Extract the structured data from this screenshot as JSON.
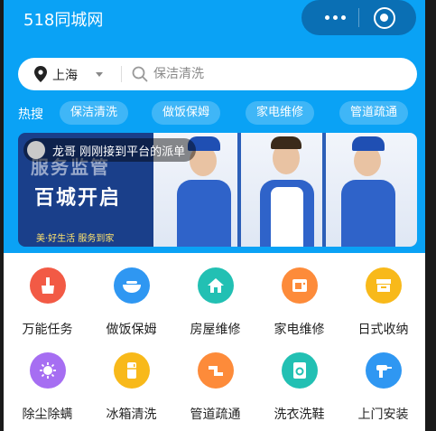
{
  "header": {
    "title": "518同城网"
  },
  "search": {
    "city": "上海",
    "placeholder": "保洁清洗"
  },
  "hot": {
    "label": "热搜",
    "chips": [
      "保洁清洗",
      "做饭保姆",
      "家电维修",
      "管道疏通"
    ]
  },
  "banner": {
    "toast": "龙哥 刚刚接到平台的派单",
    "line1": "服务监管",
    "line2": "百城开启",
    "slogan": "美·好生活  服务到家"
  },
  "services": [
    {
      "label": "万能任务",
      "icon": "broom-icon",
      "color": "#f25a45"
    },
    {
      "label": "做饭保姆",
      "icon": "bowl-icon",
      "color": "#2f97f2"
    },
    {
      "label": "房屋维修",
      "icon": "house-icon",
      "color": "#22c0b3"
    },
    {
      "label": "家电维修",
      "icon": "appliance-icon",
      "color": "#fd8b3a"
    },
    {
      "label": "日式收纳",
      "icon": "storage-box-icon",
      "color": "#f8b91a"
    },
    {
      "label": "除尘除螨",
      "icon": "mite-icon",
      "color": "#a66ef2"
    },
    {
      "label": "冰箱清洗",
      "icon": "fridge-icon",
      "color": "#f8b91a"
    },
    {
      "label": "管道疏通",
      "icon": "pipe-icon",
      "color": "#fd8b3a"
    },
    {
      "label": "洗衣洗鞋",
      "icon": "washer-icon",
      "color": "#22c0b3"
    },
    {
      "label": "上门安装",
      "icon": "drill-icon",
      "color": "#2f97f2"
    }
  ]
}
